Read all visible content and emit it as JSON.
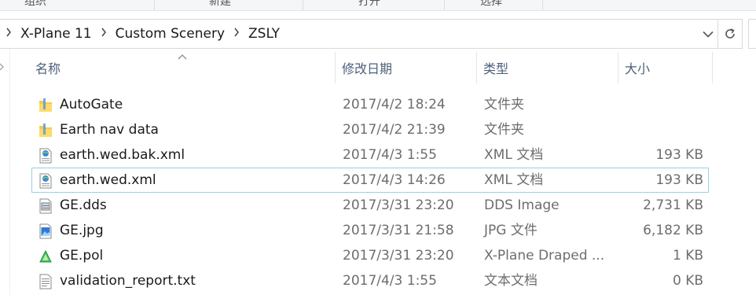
{
  "ribbon": {
    "groups": [
      "组织",
      "新建",
      "打开",
      "选择"
    ]
  },
  "address": {
    "breadcrumbs": [
      "X-Plane 11",
      "Custom Scenery",
      "ZSLY"
    ]
  },
  "columns": {
    "name": "名称",
    "modified": "修改日期",
    "type": "类型",
    "size": "大小",
    "sorted_by": "name"
  },
  "files": [
    {
      "name": "AutoGate",
      "modified": "2017/4/2 18:24",
      "type": "文件夹",
      "size": "",
      "icon": "folder-icon"
    },
    {
      "name": "Earth nav data",
      "modified": "2017/4/2 21:39",
      "type": "文件夹",
      "size": "",
      "icon": "folder-icon"
    },
    {
      "name": "earth.wed.bak.xml",
      "modified": "2017/4/3 1:55",
      "type": "XML 文档",
      "size": "193 KB",
      "icon": "xml-file-icon"
    },
    {
      "name": "earth.wed.xml",
      "modified": "2017/4/3 14:26",
      "type": "XML 文档",
      "size": "193 KB",
      "icon": "xml-file-icon",
      "selected": true
    },
    {
      "name": "GE.dds",
      "modified": "2017/3/31 23:20",
      "type": "DDS Image",
      "size": "2,731 KB",
      "icon": "dds-image-icon"
    },
    {
      "name": "GE.jpg",
      "modified": "2017/3/31 21:58",
      "type": "JPG 文件",
      "size": "6,182 KB",
      "icon": "jpg-image-icon"
    },
    {
      "name": "GE.pol",
      "modified": "2017/3/31 23:20",
      "type": "X-Plane Draped ...",
      "size": "1 KB",
      "icon": "pol-file-icon"
    },
    {
      "name": "validation_report.txt",
      "modified": "2017/4/3 1:55",
      "type": "文本文档",
      "size": "0 KB",
      "icon": "text-file-icon"
    }
  ],
  "colors": {
    "selection_border": "#99d1e0",
    "header_text": "#4c607a",
    "folder": "#f4c952"
  }
}
